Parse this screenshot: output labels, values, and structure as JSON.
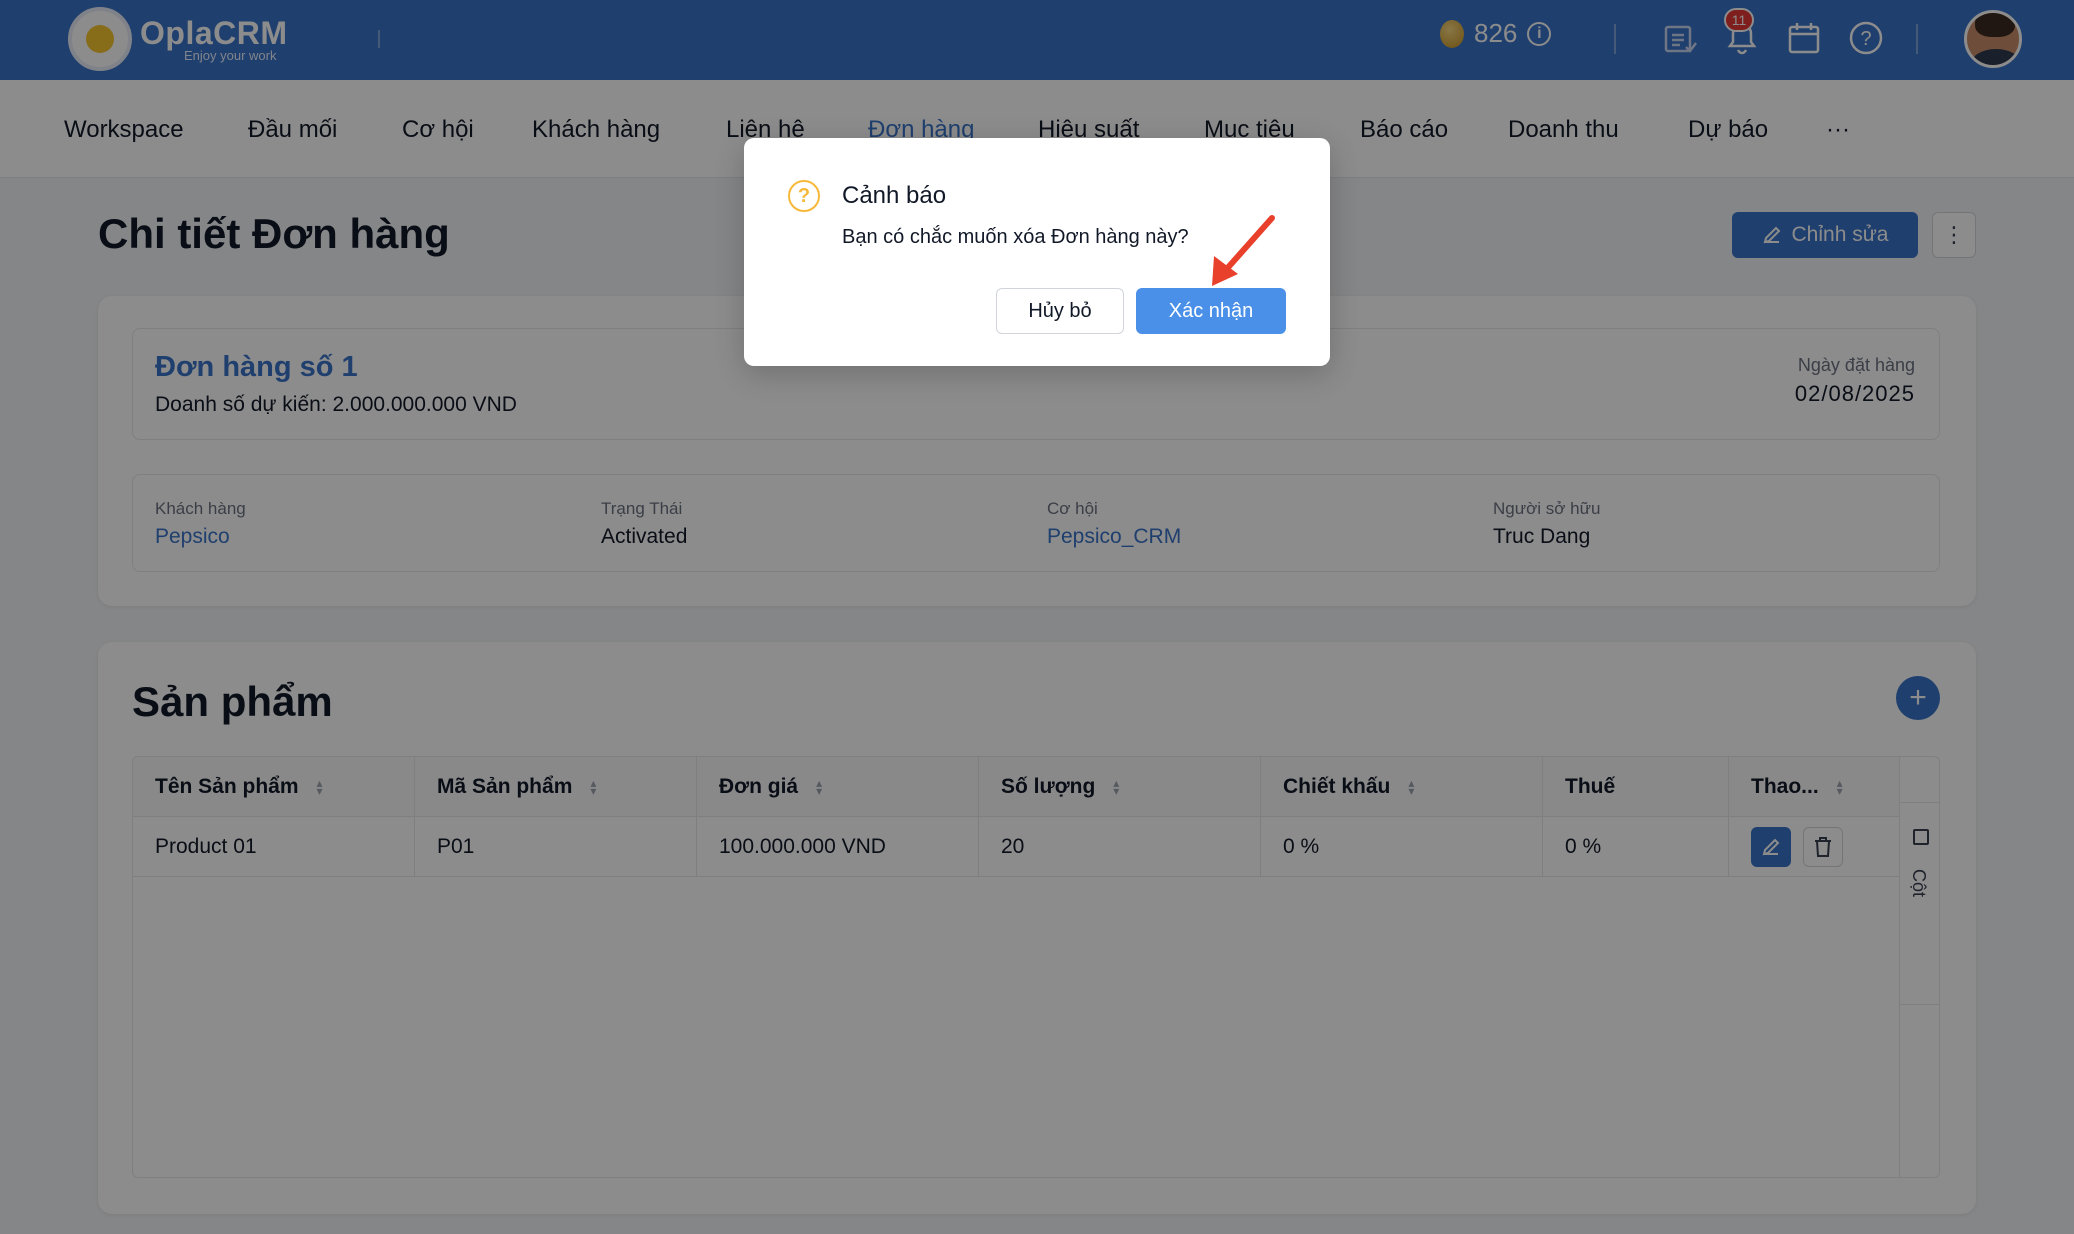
{
  "app": {
    "name": "OplaCRM",
    "tagline": "Enjoy your work"
  },
  "topbar": {
    "coins": "826",
    "notification_count": "11"
  },
  "nav": {
    "items": [
      {
        "label": "Workspace"
      },
      {
        "label": "Đầu mối"
      },
      {
        "label": "Cơ hội"
      },
      {
        "label": "Khách hàng"
      },
      {
        "label": "Liên hệ"
      },
      {
        "label": "Đơn hàng"
      },
      {
        "label": "Hiệu suất"
      },
      {
        "label": "Mục tiêu"
      },
      {
        "label": "Báo cáo"
      },
      {
        "label": "Doanh thu"
      },
      {
        "label": "Dự báo"
      },
      {
        "label": "···"
      }
    ],
    "active": "Đơn hàng"
  },
  "page": {
    "title": "Chi tiết Đơn hàng",
    "edit_label": "Chỉnh sửa",
    "more_label": "⋮"
  },
  "order": {
    "name": "Đơn hàng số 1",
    "revenue": "Doanh số dự kiến: 2.000.000.000 VND",
    "date_label": "Ngày đặt hàng",
    "date": "02/08/2025",
    "fields": [
      {
        "label": "Khách hàng",
        "value": "Pepsico",
        "link": true
      },
      {
        "label": "Trạng Thái",
        "value": "Activated",
        "link": false
      },
      {
        "label": "Cơ hội",
        "value": "Pepsico_CRM",
        "link": true
      },
      {
        "label": "Người sở hữu",
        "value": "Truc Dang",
        "link": false
      }
    ]
  },
  "products": {
    "title": "Sản phẩm",
    "add_label": "+",
    "columns": [
      "Tên Sản phẩm",
      "Mã Sản phẩm",
      "Đơn giá",
      "Số lượng",
      "Chiết khấu",
      "Thuế",
      "Thao..."
    ],
    "rows": [
      [
        "Product 01",
        "P01",
        "100.000.000 VND",
        "20",
        "0 %",
        "0 %"
      ]
    ],
    "columns_toggle": "Cột"
  },
  "modal": {
    "title": "Cảnh báo",
    "message": "Bạn có chắc muốn xóa Đơn hàng này?",
    "cancel": "Hủy bỏ",
    "confirm": "Xác nhận"
  },
  "colors": {
    "primary": "#3a73c9",
    "confirm": "#4a90e8",
    "warning": "#f6b93b",
    "annotation_arrow": "#e8402b"
  },
  "icons": {
    "question": "?"
  }
}
